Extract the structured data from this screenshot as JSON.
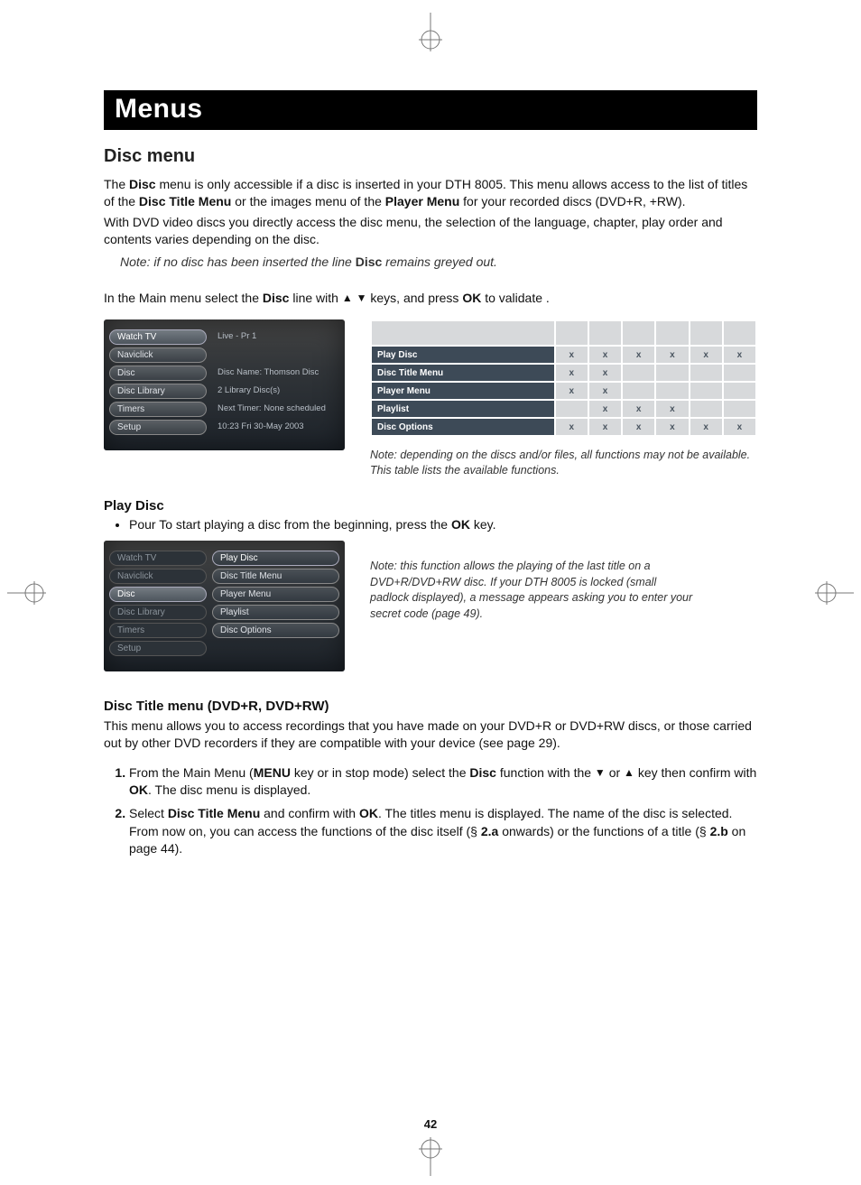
{
  "page": {
    "title": "Menus",
    "section": "Disc menu",
    "number": "42"
  },
  "intro": {
    "p1a": "The ",
    "p1b": "Disc",
    "p1c": " menu is only accessible if a disc is inserted in your DTH 8005. This menu allows access to the list of titles of the ",
    "p1d": "Disc Title Menu",
    "p1e": " or the images menu of the ",
    "p1f": "Player Menu",
    "p1g": " for your recorded discs (DVD+R, +RW).",
    "p2": "With DVD video discs you directly access the disc menu, the selection of the language, chapter, play order and contents varies depending on the disc.",
    "note_a": "Note: if no disc has been inserted the line ",
    "note_b": "Disc",
    "note_c": " remains greyed out.",
    "p3a": "In the Main menu select the ",
    "p3b": "Disc",
    "p3c": " line with ",
    "p3d": " keys, and press ",
    "p3e": "OK",
    "p3f": " to validate ."
  },
  "shot1": {
    "rows": [
      {
        "left": "Watch TV",
        "right": "Live - Pr 1",
        "sel": true
      },
      {
        "left": "Naviclick",
        "right": "",
        "sel": false
      },
      {
        "left": "Disc",
        "right": "Disc Name: Thomson Disc",
        "sel": false
      },
      {
        "left": "Disc Library",
        "right": "2 Library Disc(s)",
        "sel": false
      },
      {
        "left": "Timers",
        "right": "Next Timer: None scheduled",
        "sel": false
      },
      {
        "left": "Setup",
        "right": "10:23 Fri 30-May 2003",
        "sel": false
      }
    ]
  },
  "func_table": {
    "rows": [
      {
        "label": "Play Disc",
        "cells": [
          "x",
          "x",
          "x",
          "x",
          "x",
          "x"
        ]
      },
      {
        "label": "Disc Title Menu",
        "cells": [
          "x",
          "x",
          "",
          "",
          "",
          ""
        ]
      },
      {
        "label": "Player Menu",
        "cells": [
          "x",
          "x",
          "",
          "",
          "",
          ""
        ]
      },
      {
        "label": "Playlist",
        "cells": [
          "",
          "x",
          "x",
          "x",
          "",
          ""
        ]
      },
      {
        "label": "Disc Options",
        "cells": [
          "x",
          "x",
          "x",
          "x",
          "x",
          "x"
        ]
      }
    ],
    "note": "Note: depending on the discs and/or files, all functions may not be available. This table lists the available functions."
  },
  "play_disc": {
    "heading": "Play Disc",
    "bullet_a": "Pour To start playing a disc from the beginning, press the ",
    "bullet_b": "OK",
    "bullet_c": " key.",
    "side_note": "Note: this function allows the playing of the last title on a DVD+R/DVD+RW disc.\nIf your DTH 8005 is locked (small padlock displayed), a message appears asking you to enter your secret code (page 49)."
  },
  "shot2": {
    "left": [
      "Watch TV",
      "Naviclick",
      "Disc",
      "Disc Library",
      "Timers",
      "Setup"
    ],
    "right": [
      "Play Disc",
      "Disc Title Menu",
      "Player Menu",
      "Playlist",
      "Disc Options"
    ],
    "left_sel_index": 2,
    "right_sel_index": 0
  },
  "title_menu": {
    "heading": "Disc Title menu (DVD+R, DVD+RW)",
    "p": "This menu allows you to access recordings that you have made on your DVD+R or DVD+RW discs, or those carried out by other DVD recorders if they are compatible with your device (see page 29).",
    "step1_a": "From the Main Menu (",
    "step1_b": "MENU",
    "step1_c": " key or in stop mode) select the ",
    "step1_d": "Disc",
    "step1_e": " function with the ",
    "step1_f": " or ",
    "step1_g": " key then confirm with ",
    "step1_h": "OK",
    "step1_i": ". The disc menu is displayed.",
    "step2_a": " Select ",
    "step2_b": "Disc Title Menu",
    "step2_c": " and confirm with ",
    "step2_d": "OK",
    "step2_e": ". The titles menu is displayed. The name of the disc is selected. From now on, you can access the functions of the disc itself (§ ",
    "step2_f": "2.a",
    "step2_g": " onwards) or the functions of a title (§ ",
    "step2_h": "2.b",
    "step2_i": " on page 44)."
  }
}
